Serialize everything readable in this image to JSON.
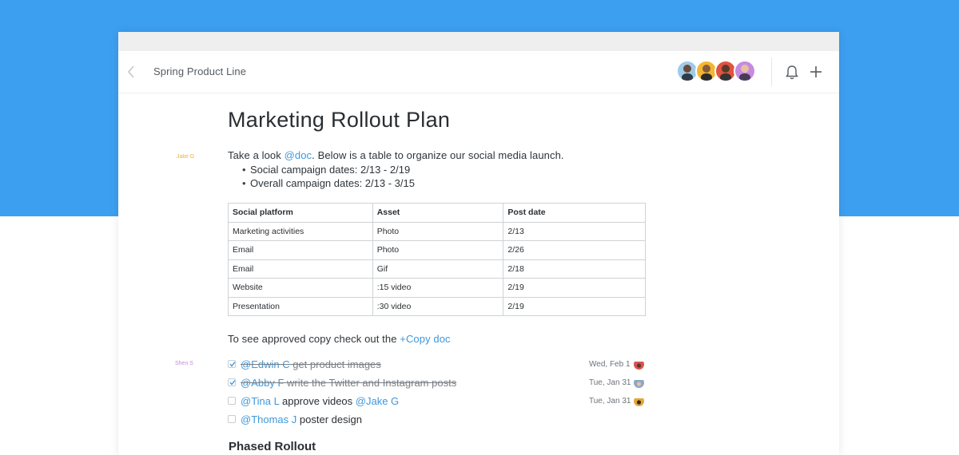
{
  "doc": {
    "breadcrumb": "Spring Product Line",
    "title": "Marketing Rollout Plan",
    "author_tags": [
      "Jake G",
      "Shen S"
    ],
    "intro": {
      "before": "Take a look ",
      "mention": "@doc",
      "after": ". Below is a table to organize our social media launch."
    },
    "bullets": [
      "Social campaign dates: 2/13 - 2/19",
      "Overall campaign dates: 2/13 - 3/15"
    ],
    "table": {
      "headers": [
        "Social platform",
        "Asset",
        "Post date"
      ],
      "rows": [
        [
          "Marketing activities",
          "Photo",
          "2/13"
        ],
        [
          "Email",
          "Photo",
          "2/26"
        ],
        [
          "Email",
          "Gif",
          "2/18"
        ],
        [
          "Website",
          ":15 video",
          "2/19"
        ],
        [
          "Presentation",
          ":30 video",
          "2/19"
        ]
      ]
    },
    "copy_line": {
      "before": "To see approved copy check out the ",
      "link": "+Copy doc"
    },
    "tasks": [
      {
        "mention": "@Edwin C",
        "text": " get product images",
        "done": true,
        "due": "Wed, Feb 1",
        "assignee_color": "#d9534f"
      },
      {
        "mention": "@Abby F",
        "text": " write the Twitter and Instagram posts",
        "done": true,
        "due": "Tue, Jan 31",
        "assignee_color": "#8aa8c8"
      },
      {
        "mention": "@Tina L",
        "text": " approve videos ",
        "mention2": "@Jake G",
        "done": false,
        "due": "Tue, Jan 31",
        "assignee_color": "#e0a93a"
      },
      {
        "mention": "@Thomas J",
        "text": " poster design",
        "done": false,
        "due": "",
        "assignee_color": ""
      }
    ],
    "section_heading": "Phased Rollout"
  },
  "theme": {
    "accent": "#3d9ff0",
    "mention": "#3f97d9"
  },
  "icons": {
    "back": "chevron-left-icon",
    "notifications": "bell-icon",
    "add": "plus-icon"
  },
  "collaborators": [
    {
      "color": "#7fb8e0"
    },
    {
      "color": "#f2b632"
    },
    {
      "color": "#e0533f"
    },
    {
      "color": "#c58be0"
    }
  ]
}
